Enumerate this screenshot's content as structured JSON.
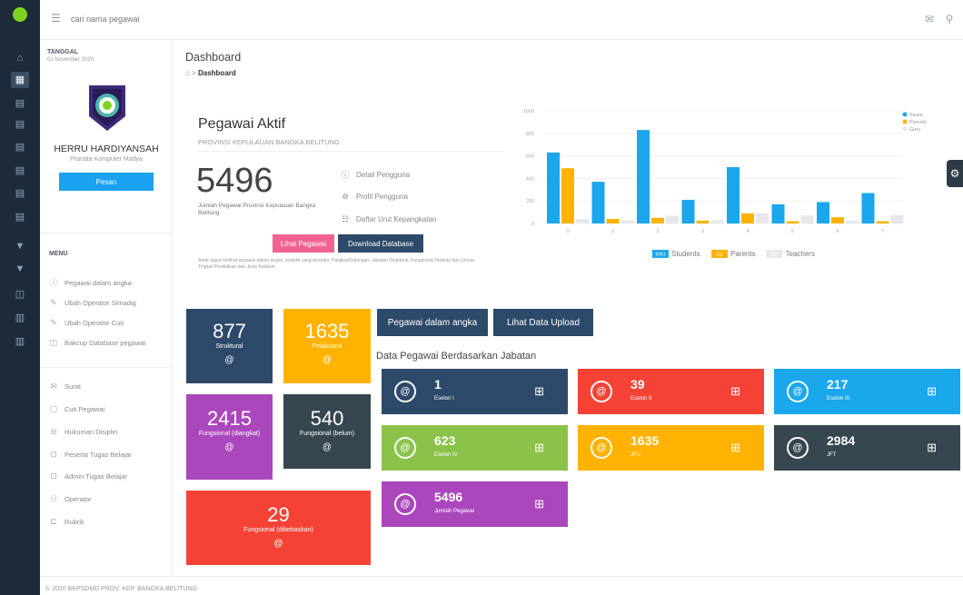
{
  "topbar": {
    "search_placeholder": "cari nama pegawai"
  },
  "sidebar": {
    "date_label": "TANGGAL",
    "date_value": "01 November 2020",
    "user_name": "HERRU HARDIYANSAH",
    "user_role": "Pranata Komputer Madya",
    "message_button": "Pesan",
    "menu_heading": "MENU",
    "menu_group1": [
      {
        "label": "Pegawai dalam angka",
        "icon": "info-icon"
      },
      {
        "label": "Ubah Operator Simadig",
        "icon": "edit-icon"
      },
      {
        "label": "Ubah Operator Cuti",
        "icon": "edit-icon"
      },
      {
        "label": "Bakcup Database pegawai",
        "icon": "backup-icon"
      }
    ],
    "menu_group2": [
      {
        "label": "Surat",
        "icon": "mail-icon"
      },
      {
        "label": "Cuti Pegawai",
        "icon": "file-icon"
      },
      {
        "label": "Hukuman Disiplin",
        "icon": "gavel-icon"
      },
      {
        "label": "Peserta Tugas Belajar",
        "icon": "book-icon"
      },
      {
        "label": "Admin Tugas Belajar",
        "icon": "book-icon"
      },
      {
        "label": "Operator",
        "icon": "users-icon"
      },
      {
        "label": "Rubrik",
        "icon": "folder-icon"
      }
    ]
  },
  "page": {
    "title": "Dashboard",
    "breadcrumb_sep": ">",
    "breadcrumb_current": "Dashboard"
  },
  "pegawai_aktif": {
    "title": "Pegawai Aktif",
    "subtitle": "PROVINSI KEPULAUAN BANGKA BELITUNG",
    "total": "5496",
    "total_desc": "Jumlah Pegawai Provinsi Kepulauan Bangka Belitung",
    "links": [
      "Detail Pengguna",
      "Profil Pengguna",
      "Daftar Urut Kepangkatan"
    ],
    "btn_lihat": "Lihat Pegawai",
    "btn_download": "Download Database",
    "note": "Anda dapat melihat pegawai dalam angka, statistik yang tersedia: Pangkat/Golongan, Jabatan Struktural, Fungsional Tertentu dan Umum, Tingkat Pendidikan dan Jenis Kelamin."
  },
  "chart_data": {
    "type": "bar",
    "categories": [
      "0",
      "1",
      "2",
      "3",
      "4",
      "5",
      "6",
      "7"
    ],
    "ylim": [
      0,
      1000
    ],
    "yticks": [
      "1000",
      "800",
      "600",
      "400",
      "200",
      "0"
    ],
    "series": [
      {
        "name": "Siswa",
        "color": "#1aa7ec",
        "values": [
          630,
          370,
          830,
          210,
          500,
          170,
          190,
          270
        ]
      },
      {
        "name": "Parents",
        "color": "#ffb300",
        "values": [
          490,
          40,
          50,
          25,
          90,
          20,
          55,
          20
        ]
      },
      {
        "name": "Guru",
        "color": "#e6e8eb",
        "values": [
          40,
          30,
          70,
          30,
          90,
          70,
          25,
          75
        ]
      }
    ],
    "legend_position": "top-right",
    "footer_legend": [
      {
        "badge": "5941",
        "label": "Students",
        "color": "#1aa7ec"
      },
      {
        "badge": "511",
        "label": "Parents",
        "color": "#ffb300"
      },
      {
        "badge": "251",
        "label": "Teachers",
        "color": "#e6e8eb"
      }
    ]
  },
  "tiles": [
    {
      "value": "877",
      "label": "Struktural",
      "color": "#2e4a6b"
    },
    {
      "value": "1635",
      "label": "Pelaksana",
      "color": "#ffb300"
    },
    {
      "value": "2415",
      "label": "Fungsional (diangkat)",
      "color": "#ab47bc"
    },
    {
      "value": "540",
      "label": "Fungsional (belum)",
      "color": "#37474f"
    },
    {
      "value": "29",
      "label": "Fungsional (dibebaskan)",
      "color": "#f44336"
    }
  ],
  "middle_buttons": [
    "Pegawai dalam angka",
    "Lihat Data Upload"
  ],
  "section_title": "Data Pegawai Berdasarkan Jabatan",
  "eselon_cards": [
    {
      "value": "1",
      "label": "Eselon I",
      "color": "#2e4a6b"
    },
    {
      "value": "39",
      "label": "Eselon II",
      "color": "#f44336"
    },
    {
      "value": "217",
      "label": "Eselon III",
      "color": "#1aa7ec"
    },
    {
      "value": "623",
      "label": "Eselon IV",
      "color": "#8bc34a"
    },
    {
      "value": "1635",
      "label": "JFU",
      "color": "#ffb300"
    },
    {
      "value": "2984",
      "label": "JFT",
      "color": "#37474f"
    },
    {
      "value": "5496",
      "label": "Jumlah Pegawai",
      "color": "#ab47bc"
    }
  ],
  "footer": "© 2020 BKPSDMD PROV. KEP. BANGKA BELITUNG"
}
